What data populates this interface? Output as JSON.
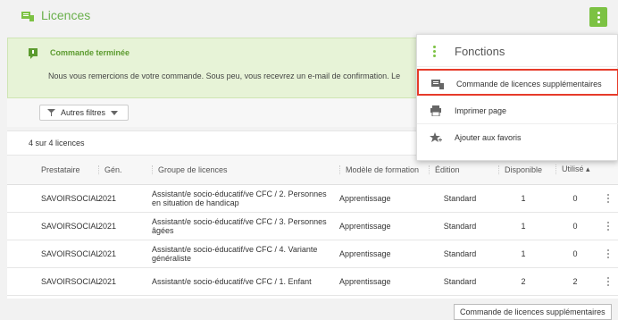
{
  "header": {
    "title": "Licences"
  },
  "success": {
    "title": "Commande terminée",
    "message": "Nous vous remercions de votre commande. Sous peu, vous recevrez un e-mail de confirmation. Le"
  },
  "filter": {
    "label": "Autres filtres"
  },
  "count_text": "4 sur 4 licences",
  "table": {
    "headers": {
      "prestataire": "Prestataire",
      "gen": "Gén.",
      "groupe": "Groupe de licences",
      "modele": "Modèle de formation",
      "edition": "Édition",
      "disponible": "Disponible",
      "utilise": "Utilisé ▴"
    },
    "rows": [
      {
        "prestataire": "SAVOIRSOCIAL",
        "gen": "2021",
        "groupe": "Assistant/e socio-éducatif/ve CFC / 2. Personnes en situation de handicap",
        "modele": "Apprentissage",
        "edition": "Standard",
        "disponible": "1",
        "utilise": "0"
      },
      {
        "prestataire": "SAVOIRSOCIAL",
        "gen": "2021",
        "groupe": "Assistant/e socio-éducatif/ve CFC / 3. Personnes âgées",
        "modele": "Apprentissage",
        "edition": "Standard",
        "disponible": "1",
        "utilise": "0"
      },
      {
        "prestataire": "SAVOIRSOCIAL",
        "gen": "2021",
        "groupe": "Assistant/e socio-éducatif/ve CFC / 4. Variante généraliste",
        "modele": "Apprentissage",
        "edition": "Standard",
        "disponible": "1",
        "utilise": "0"
      },
      {
        "prestataire": "SAVOIRSOCIAL",
        "gen": "2021",
        "groupe": "Assistant/e socio-éducatif/ve CFC / 1. Enfant",
        "modele": "Apprentissage",
        "edition": "Standard",
        "disponible": "2",
        "utilise": "2"
      }
    ]
  },
  "menu": {
    "title": "Fonctions",
    "items": [
      {
        "label": "Commande de licences supplémentaires",
        "icon": "order-licence-icon"
      },
      {
        "label": "Imprimer page",
        "icon": "printer-icon"
      },
      {
        "label": "Ajouter aux favoris",
        "icon": "star-add-icon"
      }
    ]
  },
  "tooltip": "Commande de licences supplémentaires",
  "colors": {
    "accent": "#7cc243",
    "title": "#6ab04c",
    "highlight": "#e63b2a",
    "success_bg": "#e7f3d7"
  }
}
